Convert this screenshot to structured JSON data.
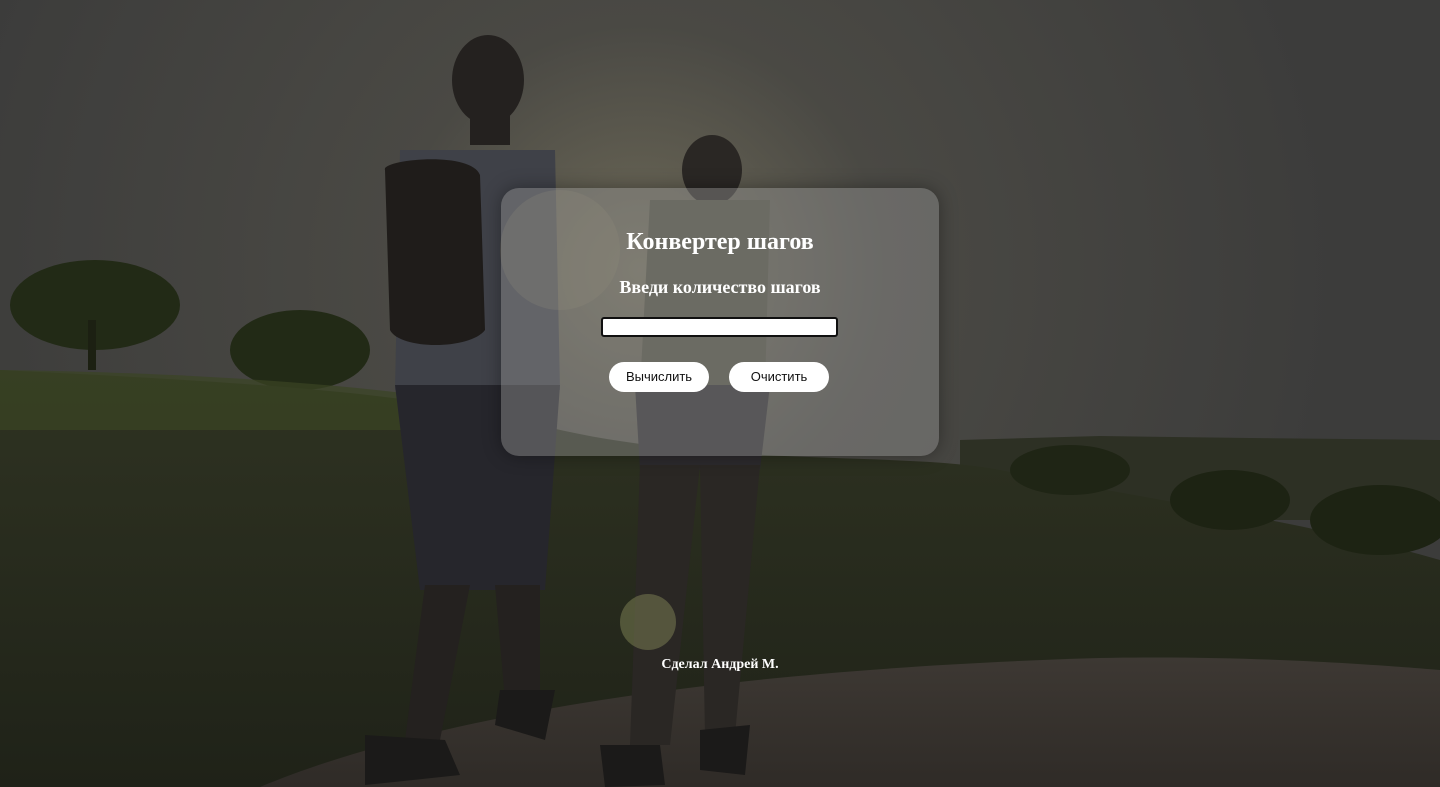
{
  "card": {
    "title": "Конвертер шагов",
    "subtitle": "Введи количество шагов",
    "input_value": "",
    "calculate_label": "Вычислить",
    "clear_label": "Очистить"
  },
  "footer": {
    "credit": "Сделал Андрей М."
  },
  "colors": {
    "overlay": "#3a3a38",
    "card_bg": "#969696",
    "text": "#ffffff",
    "button_bg": "#ffffff"
  }
}
